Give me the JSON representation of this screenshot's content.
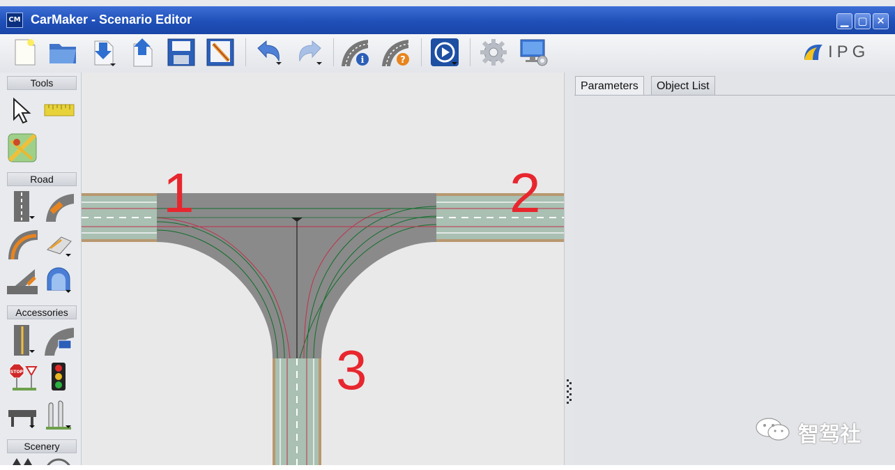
{
  "window": {
    "app_icon_label": "CM",
    "title": "CarMaker - Scenario Editor",
    "controls": [
      "minimize-icon",
      "maximize-icon",
      "close-icon"
    ]
  },
  "toolbar": {
    "buttons": [
      {
        "name": "new-file",
        "icon": "new-document-icon"
      },
      {
        "name": "open-file",
        "icon": "open-folder-icon"
      },
      {
        "name": "import",
        "icon": "import-icon",
        "has_dropdown": true
      },
      {
        "name": "export",
        "icon": "export-icon"
      },
      {
        "name": "save",
        "icon": "save-icon"
      },
      {
        "name": "save-as",
        "icon": "save-as-icon"
      },
      {
        "name": "undo",
        "icon": "undo-icon",
        "has_dropdown": true
      },
      {
        "name": "redo",
        "icon": "redo-icon",
        "has_dropdown": true
      },
      {
        "name": "road-info",
        "icon": "road-info-icon"
      },
      {
        "name": "road-help",
        "icon": "road-help-icon"
      },
      {
        "name": "play",
        "icon": "play-icon",
        "has_dropdown": true
      },
      {
        "name": "settings",
        "icon": "gear-icon"
      },
      {
        "name": "display-settings",
        "icon": "monitor-gear-icon"
      }
    ],
    "brand_logo": "IPG"
  },
  "left_panel": {
    "sections": [
      {
        "label": "Tools",
        "tools": [
          "select-arrow-icon",
          "ruler-icon",
          "map-icon"
        ]
      },
      {
        "label": "Road",
        "tools": [
          "straight-road-icon",
          "curve-road-icon",
          "turn-road-icon",
          "road-marking-icon",
          "ramp-road-icon",
          "tunnel-icon"
        ]
      },
      {
        "label": "Accessories",
        "tools": [
          "lane-marker-icon",
          "road-sign-on-curve-icon",
          "stop-sign-icon",
          "traffic-light-icon",
          "guardrail-icon",
          "bollard-icon"
        ]
      },
      {
        "label": "Scenery",
        "tools": []
      }
    ]
  },
  "canvas": {
    "labels": [
      "1",
      "2",
      "3"
    ],
    "colors": {
      "road": "#8a8a8a",
      "border": "#b89870",
      "lane_green": "#0f6e2a",
      "lane_red": "#c0304a",
      "label": "#e8262e"
    }
  },
  "right_panel": {
    "tabs": [
      {
        "label": "Parameters",
        "active": true
      },
      {
        "label": "Object List",
        "active": false
      }
    ]
  },
  "watermark": {
    "text": "智驾社"
  }
}
